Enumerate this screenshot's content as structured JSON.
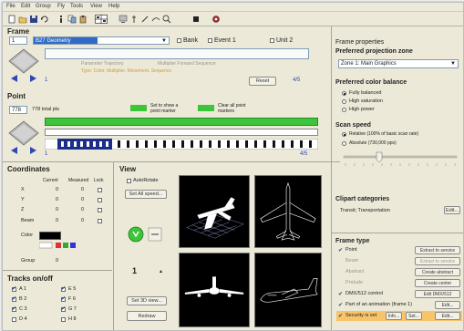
{
  "menu": {
    "items": [
      "File",
      "Edit",
      "Group",
      "Fly",
      "Tools",
      "View",
      "Help"
    ]
  },
  "toolbar": {
    "icons": [
      "new-icon",
      "open-icon",
      "save-icon",
      "undo-icon",
      "info-icon",
      "copy-icon",
      "paste-icon",
      "grid-icon",
      "display-icon",
      "tool-icon",
      "pen-icon",
      "line-icon",
      "zoom-icon",
      "plugin-icon",
      "settings-icon"
    ]
  },
  "frame": {
    "title": "Frame",
    "number": "1",
    "select_value": "B27 Geometry",
    "options": [
      "Bank",
      "Event 1",
      "Unit 2"
    ],
    "track_labels": [
      "Parameter Trajectory",
      "Multiplier Forward Sequence"
    ],
    "counter_left": "1",
    "counter_right": "4/5",
    "reset_button": "Reset",
    "color_note": "Type: Color, Multiplier, Movement, Sequence"
  },
  "point": {
    "title": "Point",
    "number": "778",
    "subtitle": "778 total pts",
    "marker1": "Set to show a point marker",
    "marker2": "Clear all point markers",
    "counter_left": "1",
    "counter_right": "4/5"
  },
  "coordinates": {
    "title": "Coordinates",
    "headers": [
      "Current",
      "Measured",
      "Lock"
    ],
    "rows": [
      {
        "label": "X",
        "cur": "0",
        "mea": "0"
      },
      {
        "label": "Y",
        "cur": "0",
        "mea": "0"
      },
      {
        "label": "Z",
        "cur": "0",
        "mea": "0"
      },
      {
        "label": "Beam",
        "cur": "0",
        "mea": "0"
      }
    ],
    "color_label": "Color",
    "group_label": "Group",
    "group_value": "0"
  },
  "tracks": {
    "title": "Tracks on/off",
    "items": [
      "A 1",
      "E 5",
      "B 2",
      "F 6",
      "C 3",
      "G 7",
      "D 4",
      "H 8"
    ]
  },
  "view": {
    "title": "View",
    "autorotate_label": "AutoRotate",
    "set_all_label": "Set All speed...",
    "speed_value": "1",
    "set_3d_label": "Set 3D view...",
    "redraw_label": "Redraw"
  },
  "frame_props": {
    "title": "Frame properties",
    "proj_title": "Preferred projection zone",
    "proj_value": "Zone 1: Main Graphics",
    "color_title": "Preferred color balance",
    "color_options": [
      "Fully balanced",
      "High saturation",
      "High power"
    ],
    "color_selected": 0,
    "scan_title": "Scan speed",
    "scan_options": [
      "Relative (100% of basic scan rate)",
      "Absolute (730,000 pps)"
    ],
    "scan_selected": 0,
    "clipart_title": "Clipart categories",
    "clipart_value": "Transit; Transportation",
    "clipart_edit": "Edit...",
    "ftype_title": "Frame type",
    "ftype_rows": [
      {
        "check": "✔",
        "label": "Point",
        "button": "Extract to service"
      },
      {
        "check": "",
        "label": "Beam",
        "button": "Extract to service"
      },
      {
        "check": "",
        "label": "Abstract",
        "button": "Create abstract"
      },
      {
        "check": "",
        "label": "Prelude",
        "button": "Create center"
      },
      {
        "check": "✔",
        "label": "DMX/512 control",
        "button": "Edit DMX/512"
      },
      {
        "check": "✔",
        "label": "Part of an animation (frame 1)",
        "button": "Edit..."
      },
      {
        "check": "✔",
        "label": "Security is set",
        "button": "Edit..."
      }
    ],
    "ftype_extra": [
      "Info...",
      "Set..."
    ]
  },
  "colors": {
    "blue_highlight": "#316ac5",
    "green_track": "#3cc43a",
    "viewport_bg": "#000000",
    "orange_highlight": "#f7c46a",
    "nav_arrow": "#2b48b4"
  }
}
